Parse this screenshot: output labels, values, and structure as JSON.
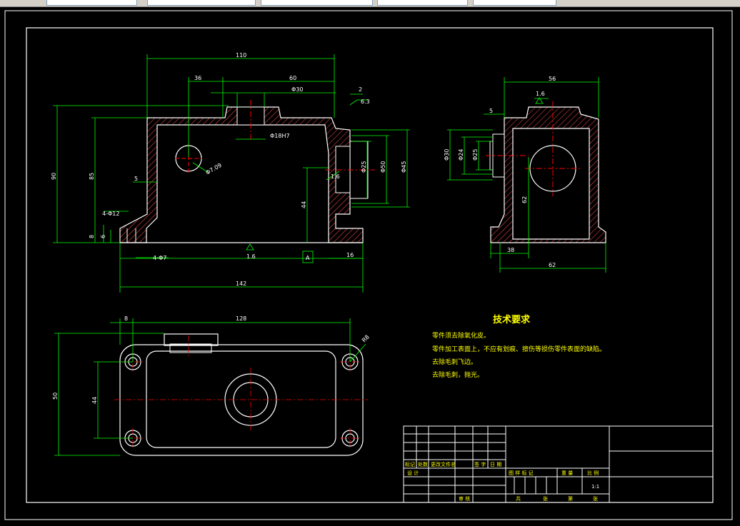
{
  "toolbar": {
    "fields": [
      "",
      "",
      "",
      "",
      ""
    ]
  },
  "colors": {
    "background": "#000000",
    "outline": "#ffffff",
    "dimension": "#00ff00",
    "hatch": "#ff4c4c",
    "centerline": "#ff0000",
    "text": "#ffff00"
  },
  "dims": {
    "front": [
      "110",
      "36",
      "60",
      "Φ30",
      "2",
      "6.3",
      "Φ18H7",
      "Φ7.09",
      "90",
      "85",
      "5",
      "4-Φ12",
      "8",
      "6",
      "4-Φ7",
      "44",
      "1.6",
      "1.6",
      "Φ25",
      "Φ50",
      "Φ45",
      "142",
      "16"
    ],
    "side": [
      "56",
      "1.6",
      "5",
      "Φ30",
      "Φ24",
      "Φ25",
      "62",
      "38",
      "62"
    ],
    "top": [
      "8",
      "128",
      "R8",
      "50",
      "44"
    ]
  },
  "datum": "A",
  "tech": {
    "title": "技术要求",
    "lines": [
      "零件须去除氧化皮。",
      "零件加工表面上，不应有划痕、擦伤等损伤零件表面的缺陷。",
      "去除毛刺飞边。",
      "去除毛刺，抛光。"
    ]
  },
  "title_block": {
    "row1": [
      "标记",
      "处数",
      "更改文件名",
      "签 字",
      "日 期"
    ],
    "row2": [
      "设 计"
    ],
    "row3": [
      "审 核"
    ],
    "stage_header": [
      "图 样 标 记",
      "重 量",
      "比 例"
    ],
    "scale": "1:1",
    "sheets": [
      "共",
      "张",
      "第",
      "张"
    ]
  }
}
